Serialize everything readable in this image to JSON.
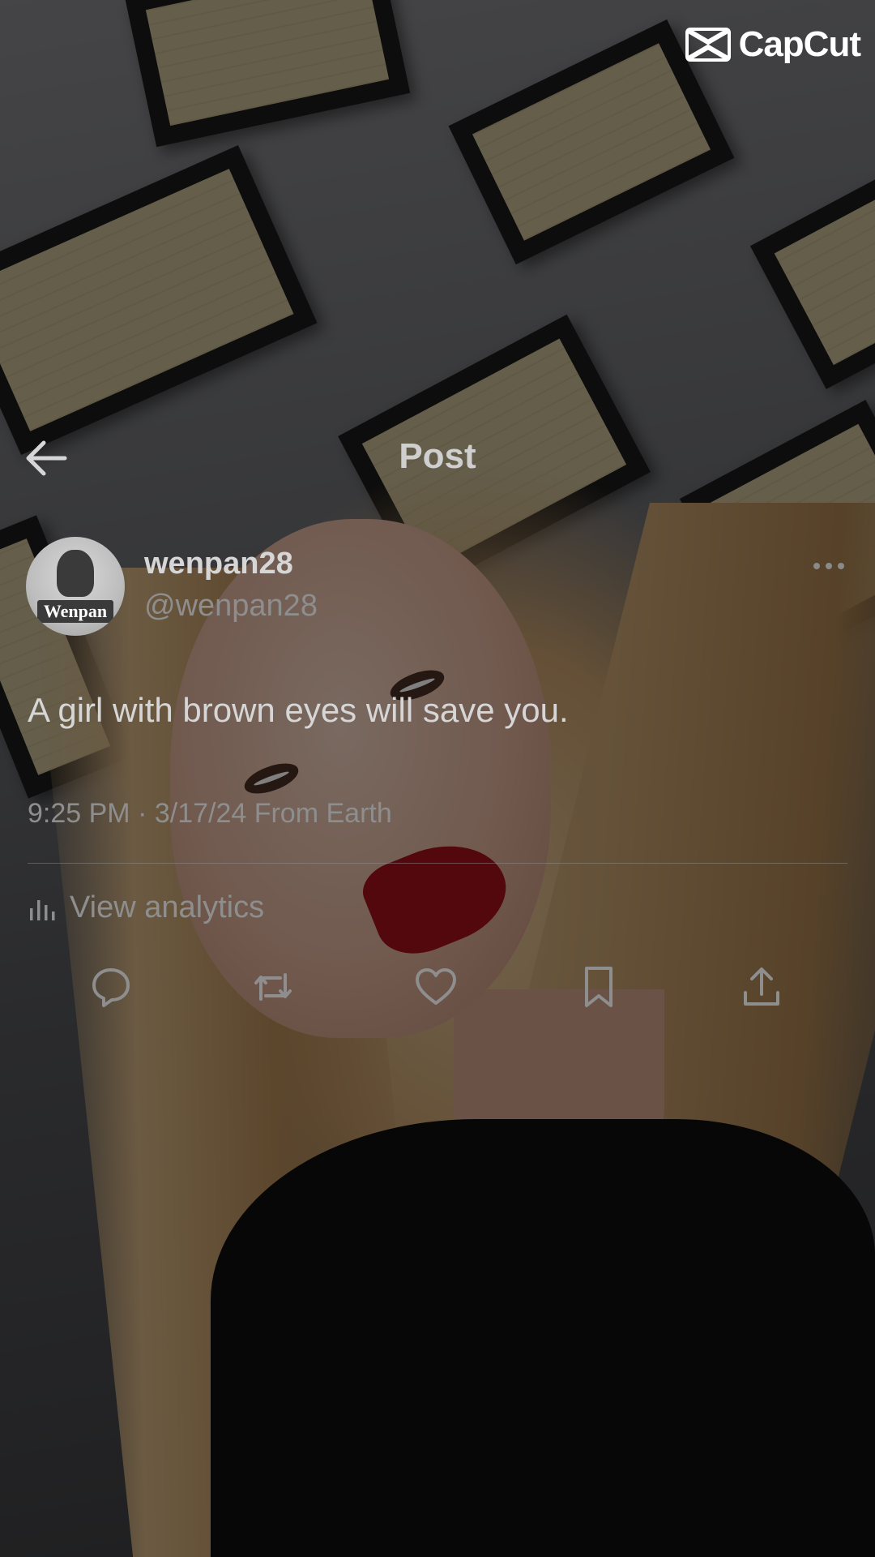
{
  "watermark": {
    "text": "CapCut",
    "icon": "capcut-logo-icon"
  },
  "header": {
    "back_icon": "back-arrow-icon",
    "title": "Post"
  },
  "author": {
    "avatar_icon": "avatar-image",
    "avatar_tag": "Wenpan",
    "display_name": "wenpan28",
    "handle": "@wenpan28",
    "more_icon": "more-options-icon"
  },
  "post": {
    "text": "A girl with brown eyes will save you.",
    "meta": "9:25 PM · 3/17/24 From Earth"
  },
  "analytics": {
    "icon": "bar-chart-icon",
    "label": "View analytics"
  },
  "actions": [
    {
      "name": "reply",
      "icon": "reply-bubble-icon"
    },
    {
      "name": "repost",
      "icon": "repost-icon"
    },
    {
      "name": "like",
      "icon": "heart-icon"
    },
    {
      "name": "bookmark",
      "icon": "bookmark-icon"
    },
    {
      "name": "share",
      "icon": "share-upload-icon"
    }
  ],
  "colors": {
    "text_primary": "#d6d6d6",
    "text_secondary": "#8e8e8e",
    "overlay": "rgba(0,0,0,0.5)",
    "lipstick": "#a4111a"
  }
}
